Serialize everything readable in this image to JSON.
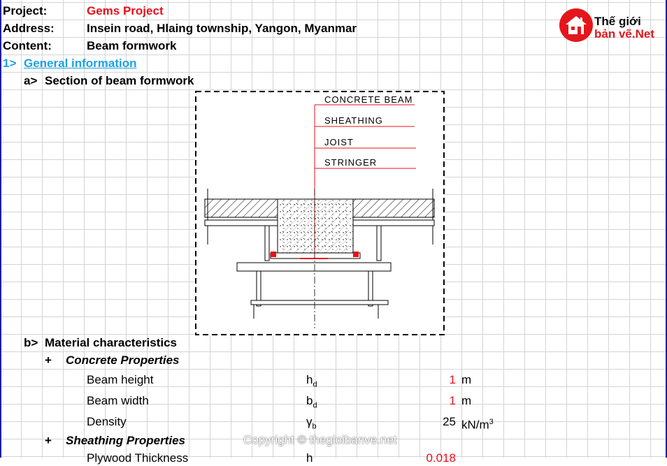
{
  "header": {
    "project_label": "Project:",
    "project_value": "Gems Project",
    "address_label": "Address:",
    "address_value": "Insein road, Hlaing township, Yangon, Myanmar",
    "content_label": "Content:",
    "content_value": "Beam formwork"
  },
  "logo": {
    "line1": "Thế giới",
    "line2": "bản vẽ.Net"
  },
  "section1": {
    "number": "1>",
    "title": "General information"
  },
  "sub_a": {
    "marker": "a>",
    "title": "Section of beam formwork"
  },
  "drawing": {
    "labels": [
      "CONCRETE BEAM",
      "SHEATHING",
      "JOIST",
      "STRINGER"
    ]
  },
  "sub_b": {
    "marker": "b>",
    "title": "Material characteristics"
  },
  "concrete": {
    "marker": "+",
    "title": "Concrete Properties",
    "rows": [
      {
        "name": "Beam height",
        "symbol": "h",
        "subscript": "d",
        "value": "1",
        "unit": "m",
        "unit_sup": ""
      },
      {
        "name": "Beam width",
        "symbol": "b",
        "subscript": "d",
        "value": "1",
        "unit": "m",
        "unit_sup": ""
      },
      {
        "name": "Density",
        "symbol": "γ",
        "subscript": "b",
        "value": "25",
        "unit": "kN/m",
        "unit_sup": "3"
      }
    ]
  },
  "sheathing": {
    "marker": "+",
    "title": "Sheathing Properties",
    "partial_row": {
      "name": "Plywood Thickness",
      "symbol": "h",
      "value": "0.018"
    }
  },
  "watermark": "Copyright © thegioibanve.net",
  "colors": {
    "accent_red": "#e8101a",
    "link_blue": "#1ba1e2",
    "gridline": "#d4d4d4"
  }
}
